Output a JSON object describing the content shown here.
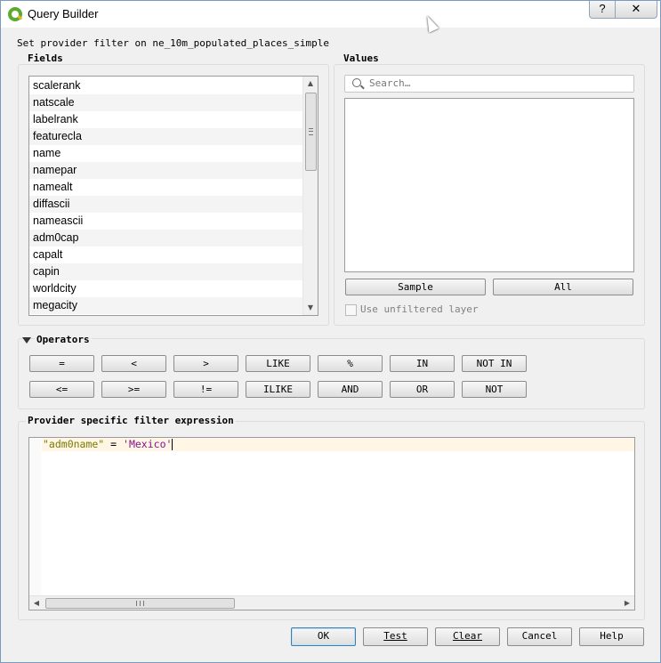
{
  "window": {
    "title": "Query Builder",
    "help_label": "?",
    "close_label": "✕"
  },
  "provider_label": "Set provider filter on ne_10m_populated_places_simple",
  "fields": {
    "title": "Fields",
    "items": [
      "scalerank",
      "natscale",
      "labelrank",
      "featurecla",
      "name",
      "namepar",
      "namealt",
      "diffascii",
      "nameascii",
      "adm0cap",
      "capalt",
      "capin",
      "worldcity",
      "megacity"
    ],
    "scroll_up": "▲",
    "scroll_down": "▼"
  },
  "values": {
    "title": "Values",
    "search_placeholder": "Search…",
    "sample_label": "Sample",
    "all_label": "All",
    "unfiltered_label": "Use unfiltered layer"
  },
  "operators": {
    "title": "Operators",
    "row1": [
      "=",
      "<",
      ">",
      "LIKE",
      "%",
      "IN",
      "NOT IN"
    ],
    "row2": [
      "<=",
      ">=",
      "!=",
      "ILIKE",
      "AND",
      "OR",
      "NOT"
    ]
  },
  "expression": {
    "title": "Provider specific filter expression",
    "field": "\"adm0name\"",
    "operator": " = ",
    "value": "'Mexico'",
    "scroll_left": "◀",
    "scroll_right": "▶"
  },
  "buttons": {
    "ok": "OK",
    "test": "Test",
    "clear": "Clear",
    "cancel": "Cancel",
    "help": "Help"
  }
}
